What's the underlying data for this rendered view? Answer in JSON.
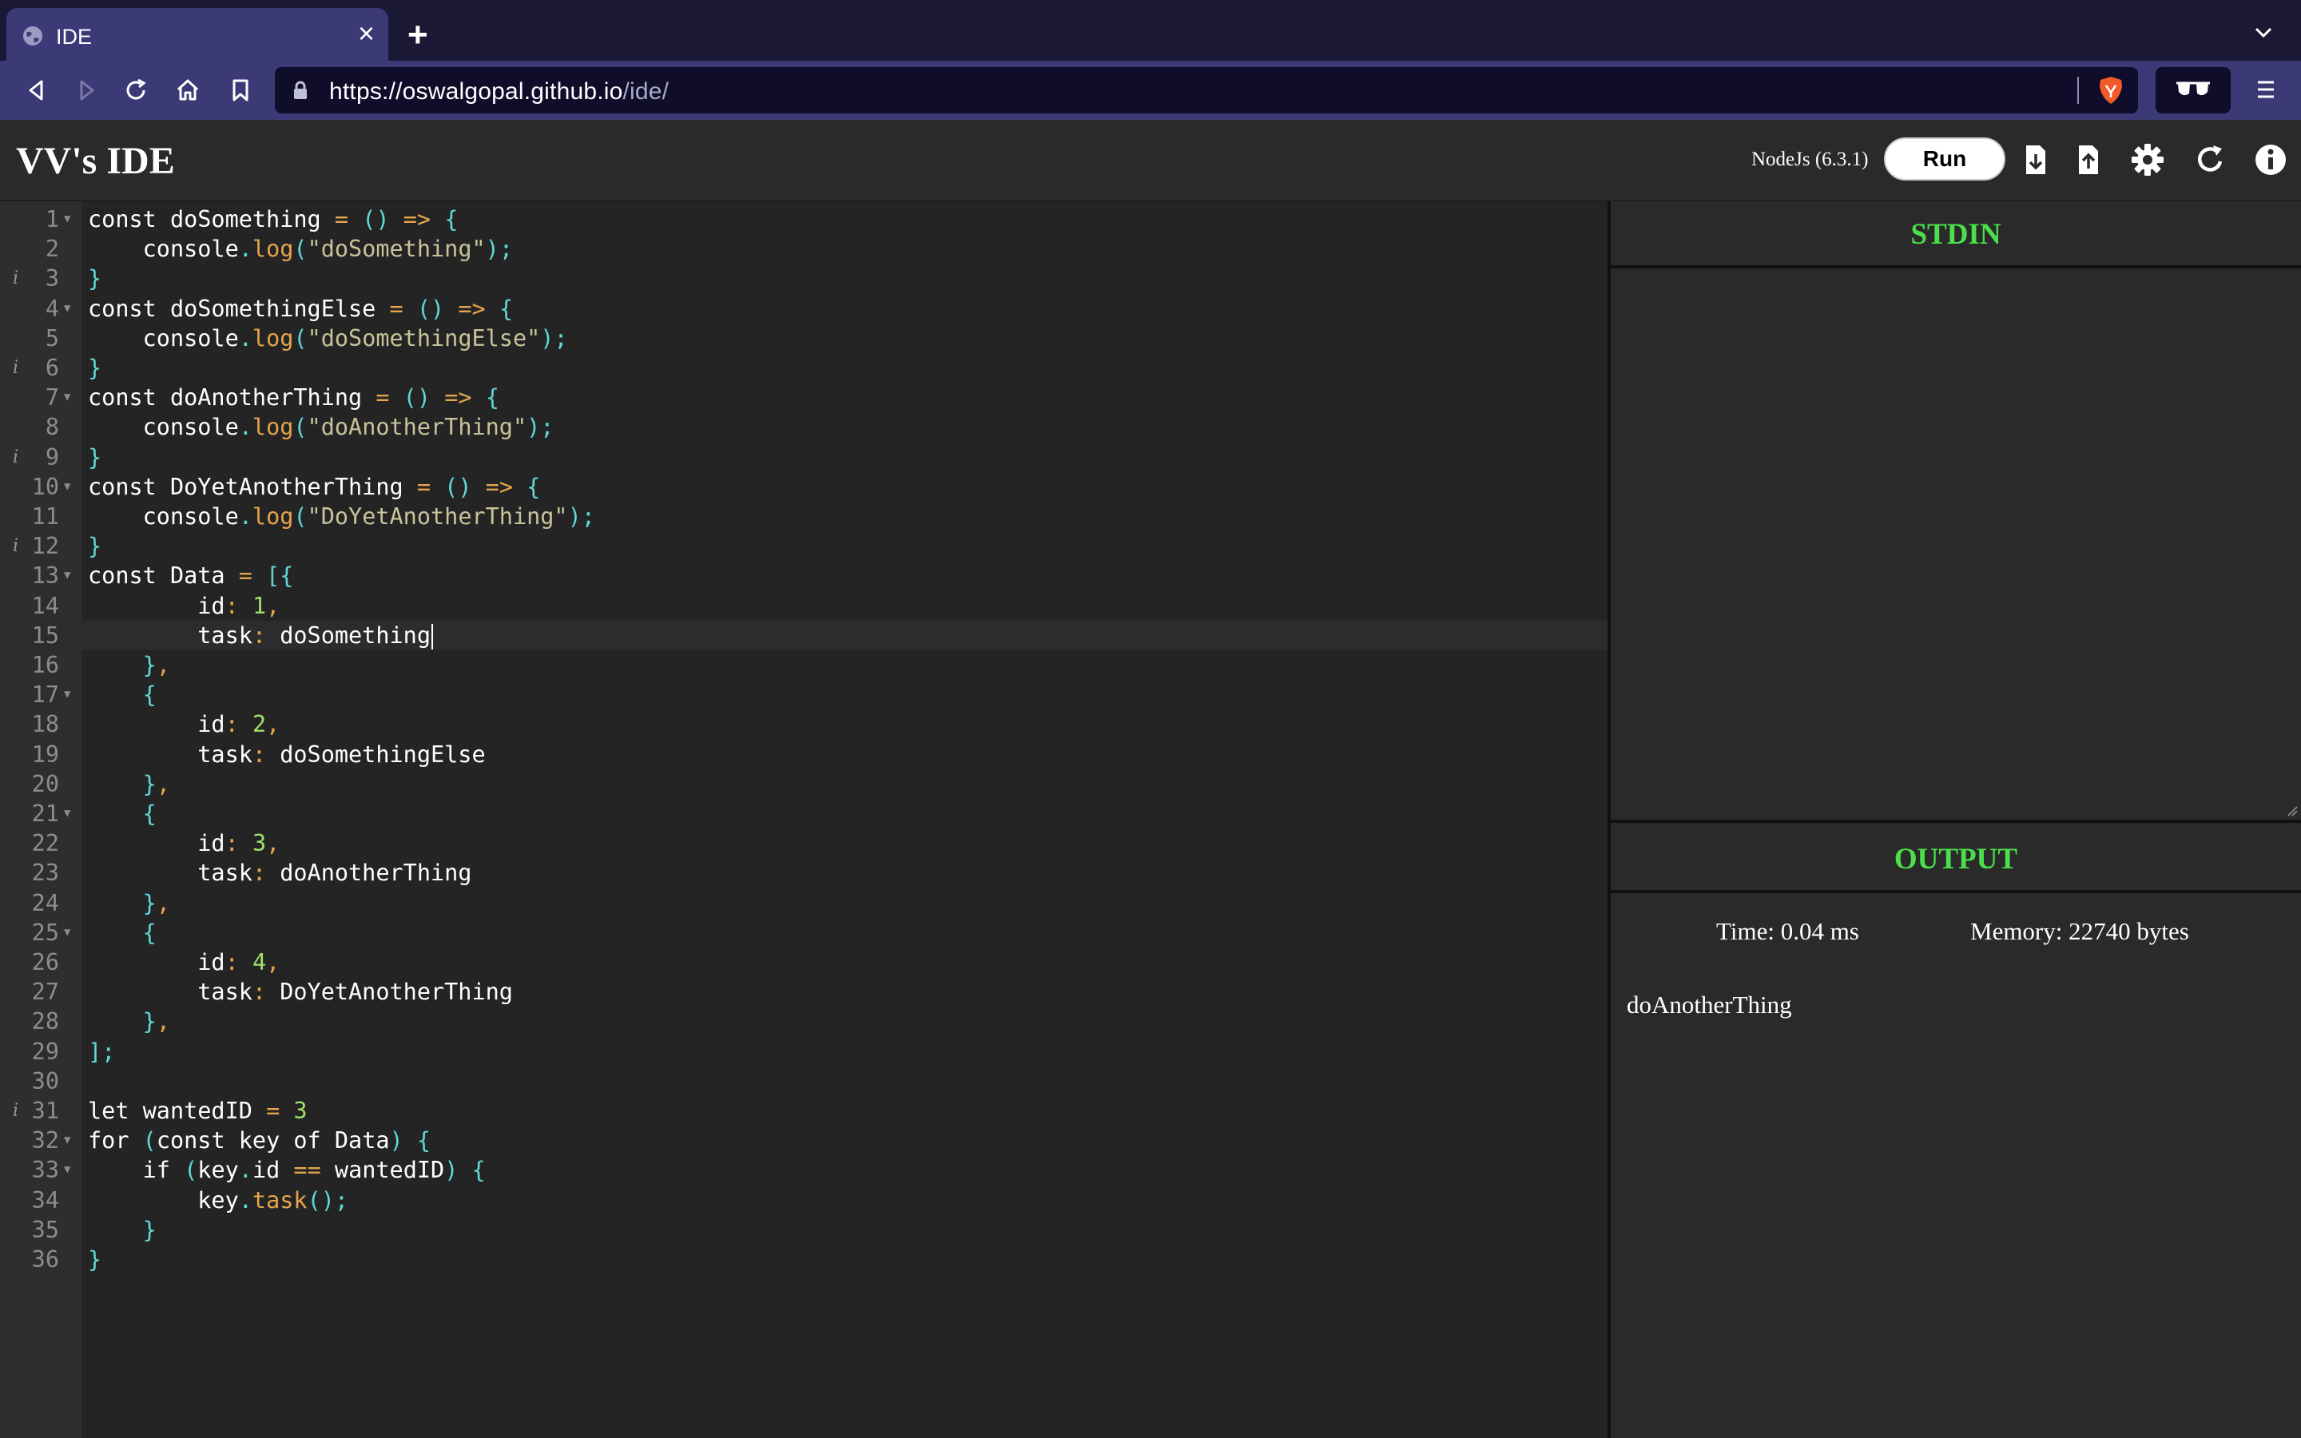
{
  "browser": {
    "tab_title": "IDE",
    "url_host": "https://oswalgopal.github.io",
    "url_path": "/ide/"
  },
  "app": {
    "title": "VV's IDE",
    "language": "NodeJs (6.3.1)",
    "run_label": "Run"
  },
  "editor": {
    "active_line": 15,
    "lines": [
      {
        "n": "1",
        "fold": true,
        "info": false
      },
      {
        "n": "2"
      },
      {
        "n": "3",
        "info": true
      },
      {
        "n": "4",
        "fold": true
      },
      {
        "n": "5"
      },
      {
        "n": "6",
        "info": true
      },
      {
        "n": "7",
        "fold": true
      },
      {
        "n": "8"
      },
      {
        "n": "9",
        "info": true
      },
      {
        "n": "10",
        "fold": true
      },
      {
        "n": "11"
      },
      {
        "n": "12",
        "info": true
      },
      {
        "n": "13",
        "fold": true
      },
      {
        "n": "14"
      },
      {
        "n": "15"
      },
      {
        "n": "16"
      },
      {
        "n": "17",
        "fold": true
      },
      {
        "n": "18"
      },
      {
        "n": "19"
      },
      {
        "n": "20"
      },
      {
        "n": "21",
        "fold": true
      },
      {
        "n": "22"
      },
      {
        "n": "23"
      },
      {
        "n": "24"
      },
      {
        "n": "25",
        "fold": true
      },
      {
        "n": "26"
      },
      {
        "n": "27"
      },
      {
        "n": "28"
      },
      {
        "n": "29"
      },
      {
        "n": "30"
      },
      {
        "n": "31",
        "info": true
      },
      {
        "n": "32",
        "fold": true
      },
      {
        "n": "33",
        "fold": true
      },
      {
        "n": "34"
      },
      {
        "n": "35"
      },
      {
        "n": "36"
      }
    ],
    "code": [
      "const doSomething = () => {",
      "    console.log(\"doSomething\");",
      "}",
      "const doSomethingElse = () => {",
      "    console.log(\"doSomethingElse\");",
      "}",
      "const doAnotherThing = () => {",
      "    console.log(\"doAnotherThing\");",
      "}",
      "const DoYetAnotherThing = () => {",
      "    console.log(\"DoYetAnotherThing\");",
      "}",
      "const Data = [{",
      "        id: 1,",
      "        task: doSomething",
      "    },",
      "    {",
      "        id: 2,",
      "        task: doSomethingElse",
      "    },",
      "    {",
      "        id: 3,",
      "        task: doAnotherThing",
      "    },",
      "    {",
      "        id: 4,",
      "        task: DoYetAnotherThing",
      "    },",
      "];",
      "",
      "let wantedID = 3",
      "for (const key of Data) {",
      "    if (key.id == wantedID) {",
      "        key.task();",
      "    }",
      "}"
    ]
  },
  "panel": {
    "stdin_title": "STDIN",
    "output_title": "OUTPUT",
    "time": "Time: 0.04 ms",
    "memory": "Memory: 22740 bytes",
    "output": "doAnotherThing"
  },
  "colors": {
    "accent_green": "#4be04b",
    "browser_chrome": "#3b3a77",
    "editor_bg": "#242424"
  }
}
